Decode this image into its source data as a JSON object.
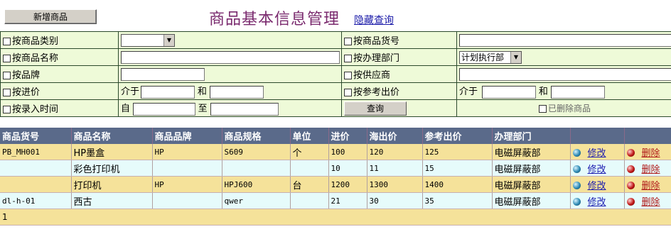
{
  "header": {
    "new_button": "新增商品",
    "title": "商品基本信息管理",
    "hide_query_link": "隐藏查询"
  },
  "filters": {
    "by_category": "按商品类别",
    "by_code": "按商品货号",
    "by_name": "按商品名称",
    "by_dept": "按办理部门",
    "dept_selected": "计划执行部",
    "by_brand": "按品牌",
    "by_supplier": "按供应商",
    "by_price": "按进价",
    "between": "介于",
    "and": "和",
    "by_ref_price": "按参考出价",
    "by_entry_time": "按录入时间",
    "from": "自",
    "to": "至",
    "query_button": "查询",
    "deleted_goods": "已删除商品"
  },
  "table": {
    "headers": [
      "商品货号",
      "商品名称",
      "商品品牌",
      "商品规格",
      "单位",
      "进价",
      "海出价",
      "参考出价",
      "办理部门",
      "",
      ""
    ],
    "rows": [
      {
        "code": "PB_MH001",
        "name": "HP墨盒",
        "brand": "HP",
        "spec": "S609",
        "unit": "个",
        "cost": "100",
        "sea": "120",
        "ref": "125",
        "dept": "电磁屏蔽部",
        "edit": "修改",
        "del": "删除"
      },
      {
        "code": "",
        "name": "彩色打印机",
        "brand": "",
        "spec": "",
        "unit": "",
        "cost": "10",
        "sea": "11",
        "ref": "15",
        "dept": "电磁屏蔽部",
        "edit": "修改",
        "del": "删除"
      },
      {
        "code": "",
        "name": "打印机",
        "brand": "HP",
        "spec": "HPJ600",
        "unit": "台",
        "cost": "1200",
        "sea": "1300",
        "ref": "1400",
        "dept": "电磁屏蔽部",
        "edit": "修改",
        "del": "删除"
      },
      {
        "code": "dl-h-01",
        "name": "西古",
        "brand": "",
        "spec": "qwer",
        "unit": "",
        "cost": "21",
        "sea": "30",
        "ref": "35",
        "dept": "电磁屏蔽部",
        "edit": "修改",
        "del": "删除"
      }
    ],
    "footer_count": "1"
  }
}
